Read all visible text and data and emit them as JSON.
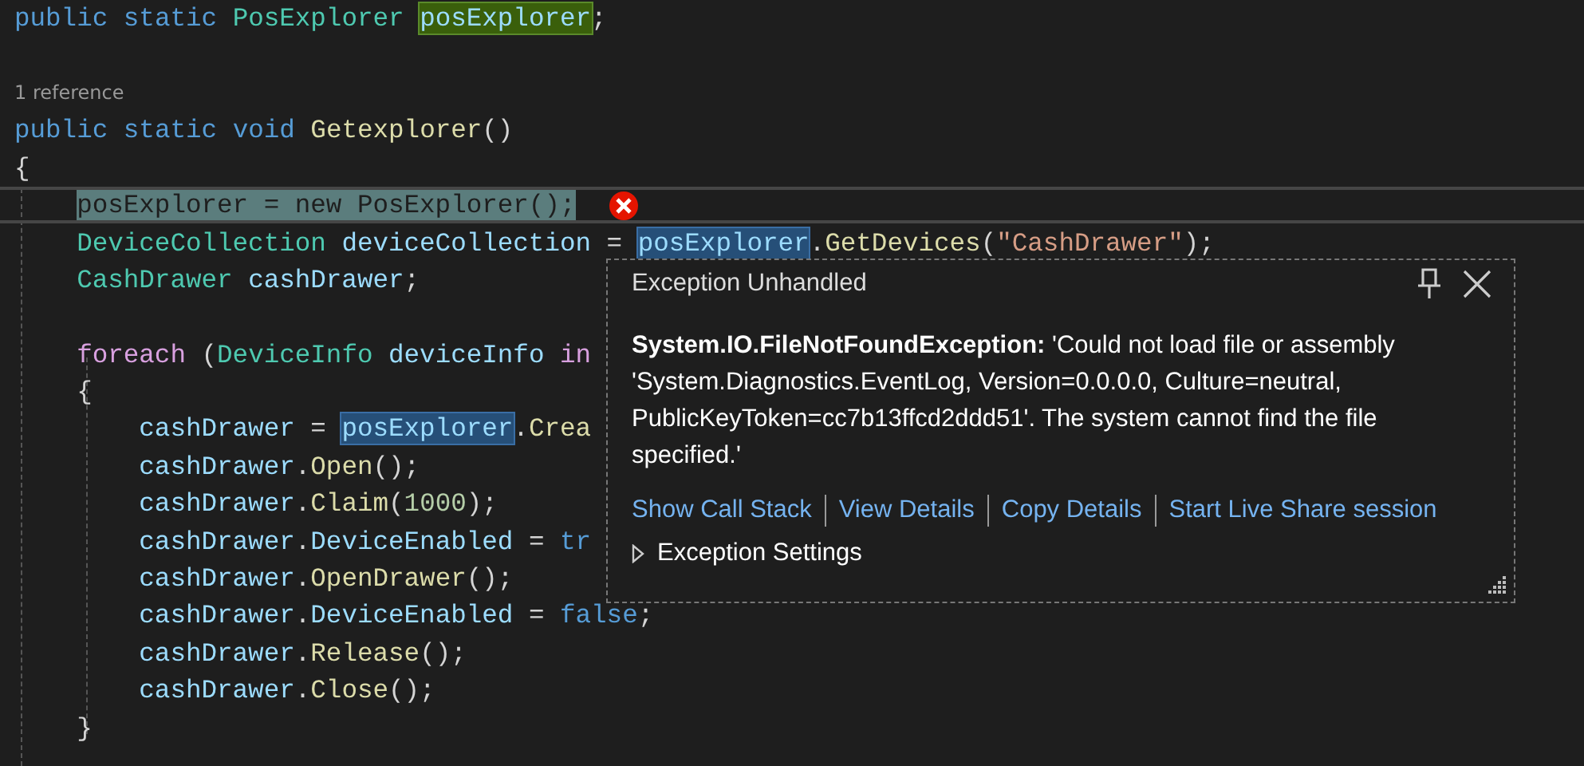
{
  "code_lines": [
    {
      "kind": "code",
      "tokens": [
        {
          "text": "public ",
          "kind": "kw"
        },
        {
          "text": "static ",
          "kind": "kw"
        },
        {
          "text": "PosExplorer ",
          "kind": "type"
        },
        {
          "text": "posExplorer",
          "kind": "var",
          "definition": true
        },
        {
          "text": ";",
          "kind": "plain"
        }
      ]
    },
    {
      "kind": "blank"
    },
    {
      "kind": "codelens",
      "text": "1 reference"
    },
    {
      "kind": "code",
      "tokens": [
        {
          "text": "public ",
          "kind": "kw"
        },
        {
          "text": "static ",
          "kind": "kw"
        },
        {
          "text": "void ",
          "kind": "kw"
        },
        {
          "text": "Getexplorer",
          "kind": "method"
        },
        {
          "text": "()",
          "kind": "plain"
        }
      ]
    },
    {
      "kind": "code",
      "tokens": [
        {
          "text": "{",
          "kind": "plain"
        }
      ],
      "children": [
        {
          "kind": "code",
          "current": true,
          "error": true,
          "tokens": [
            {
              "text": "posExplorer = new PosExplorer();",
              "kind": "plain"
            }
          ]
        },
        {
          "kind": "code",
          "tokens": [
            {
              "text": "DeviceCollection ",
              "kind": "type"
            },
            {
              "text": "deviceCollection ",
              "kind": "var"
            },
            {
              "text": "= ",
              "kind": "plain"
            },
            {
              "text": "posExplorer",
              "kind": "var",
              "reference": true
            },
            {
              "text": ".",
              "kind": "plain"
            },
            {
              "text": "GetDevices",
              "kind": "method"
            },
            {
              "text": "(",
              "kind": "plain"
            },
            {
              "text": "\"CashDrawer\"",
              "kind": "string"
            },
            {
              "text": ");",
              "kind": "plain"
            }
          ]
        },
        {
          "kind": "code",
          "tokens": [
            {
              "text": "CashDrawer ",
              "kind": "type"
            },
            {
              "text": "cashDrawer",
              "kind": "var"
            },
            {
              "text": ";",
              "kind": "plain"
            }
          ]
        },
        {
          "kind": "blank"
        },
        {
          "kind": "code",
          "tokens": [
            {
              "text": "foreach ",
              "kind": "ctrl"
            },
            {
              "text": "(",
              "kind": "plain"
            },
            {
              "text": "DeviceInfo ",
              "kind": "type"
            },
            {
              "text": "deviceInfo ",
              "kind": "var"
            },
            {
              "text": "in",
              "kind": "ctrl"
            }
          ]
        },
        {
          "kind": "code",
          "tokens": [
            {
              "text": "{",
              "kind": "plain"
            }
          ],
          "children": [
            {
              "kind": "code",
              "tokens": [
                {
                  "text": "cashDrawer ",
                  "kind": "var"
                },
                {
                  "text": "= ",
                  "kind": "plain"
                },
                {
                  "text": "posExplorer",
                  "kind": "var",
                  "reference": true
                },
                {
                  "text": ".",
                  "kind": "plain"
                },
                {
                  "text": "Crea",
                  "kind": "method"
                }
              ]
            },
            {
              "kind": "code",
              "tokens": [
                {
                  "text": "cashDrawer",
                  "kind": "var"
                },
                {
                  "text": ".",
                  "kind": "plain"
                },
                {
                  "text": "Open",
                  "kind": "method"
                },
                {
                  "text": "();",
                  "kind": "plain"
                }
              ]
            },
            {
              "kind": "code",
              "tokens": [
                {
                  "text": "cashDrawer",
                  "kind": "var"
                },
                {
                  "text": ".",
                  "kind": "plain"
                },
                {
                  "text": "Claim",
                  "kind": "method"
                },
                {
                  "text": "(",
                  "kind": "plain"
                },
                {
                  "text": "1000",
                  "kind": "number"
                },
                {
                  "text": ");",
                  "kind": "plain"
                }
              ]
            },
            {
              "kind": "code",
              "tokens": [
                {
                  "text": "cashDrawer",
                  "kind": "var"
                },
                {
                  "text": ".",
                  "kind": "plain"
                },
                {
                  "text": "DeviceEnabled ",
                  "kind": "var"
                },
                {
                  "text": "= ",
                  "kind": "plain"
                },
                {
                  "text": "tr",
                  "kind": "kw"
                }
              ]
            },
            {
              "kind": "code",
              "tokens": [
                {
                  "text": "cashDrawer",
                  "kind": "var"
                },
                {
                  "text": ".",
                  "kind": "plain"
                },
                {
                  "text": "OpenDrawer",
                  "kind": "method"
                },
                {
                  "text": "();",
                  "kind": "plain"
                }
              ]
            },
            {
              "kind": "code",
              "tokens": [
                {
                  "text": "cashDrawer",
                  "kind": "var"
                },
                {
                  "text": ".",
                  "kind": "plain"
                },
                {
                  "text": "DeviceEnabled ",
                  "kind": "var"
                },
                {
                  "text": "= ",
                  "kind": "plain"
                },
                {
                  "text": "false",
                  "kind": "kw"
                },
                {
                  "text": ";",
                  "kind": "plain"
                }
              ]
            },
            {
              "kind": "code",
              "tokens": [
                {
                  "text": "cashDrawer",
                  "kind": "var"
                },
                {
                  "text": ".",
                  "kind": "plain"
                },
                {
                  "text": "Release",
                  "kind": "method"
                },
                {
                  "text": "();",
                  "kind": "plain"
                }
              ]
            },
            {
              "kind": "code",
              "tokens": [
                {
                  "text": "cashDrawer",
                  "kind": "var"
                },
                {
                  "text": ".",
                  "kind": "plain"
                },
                {
                  "text": "Close",
                  "kind": "method"
                },
                {
                  "text": "();",
                  "kind": "plain"
                }
              ]
            }
          ]
        },
        {
          "kind": "code",
          "tokens": [
            {
              "text": "}",
              "kind": "plain"
            }
          ]
        }
      ]
    }
  ],
  "exception_popup": {
    "title": "Exception Unhandled",
    "message": "**System.IO.FileNotFoundException:** 'Could not load file or assembly 'System.Diagnostics.EventLog, Version=0.0.0.0, Culture=neutral, PublicKeyToken=cc7b13ffcd2ddd51'. The system cannot find the file specified.'",
    "links": [
      "Show Call Stack",
      "View Details",
      "Copy Details",
      "Start Live Share session"
    ],
    "settings": {
      "label": "Exception Settings",
      "expanded": false
    }
  }
}
